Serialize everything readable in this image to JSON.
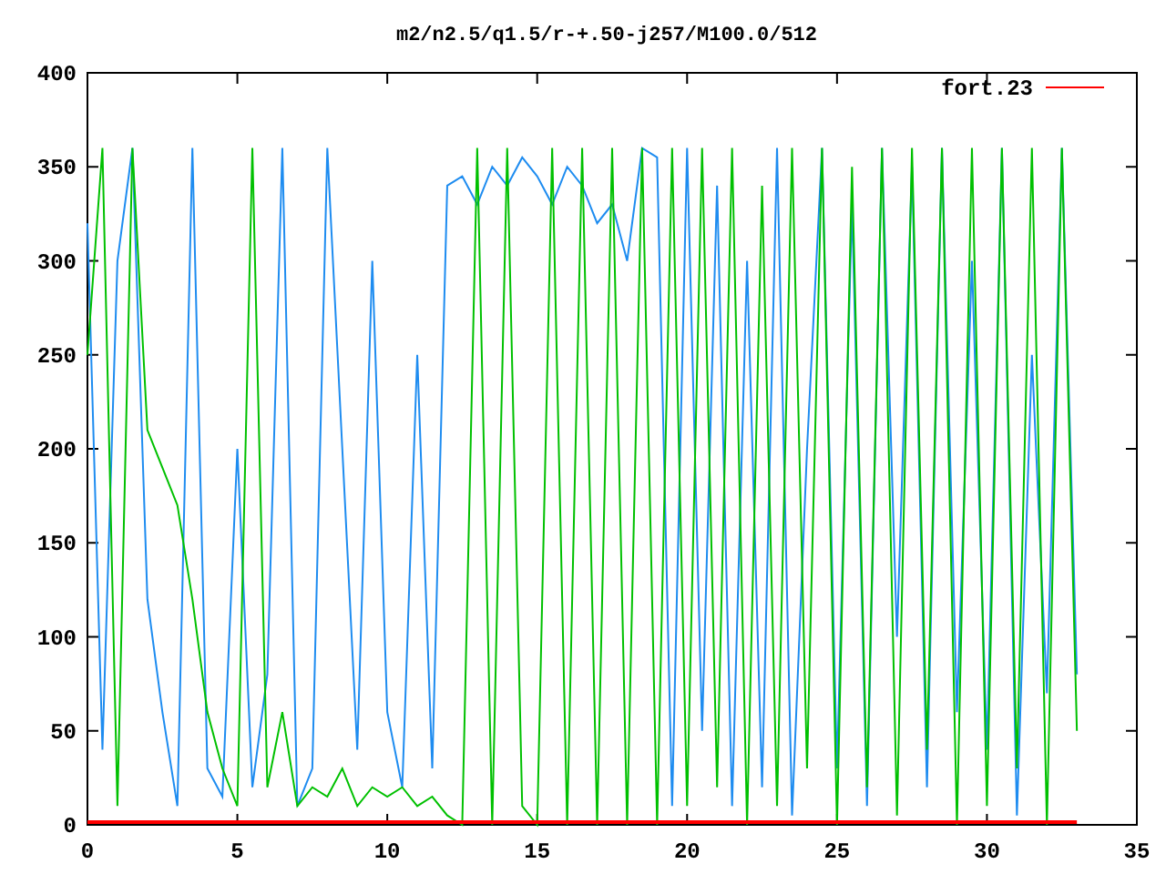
{
  "chart": {
    "chart_data": {
      "type": "line",
      "title": "m2/n2.5/q1.5/r-+.50-j257/M100.0/512",
      "x": [
        0,
        0.5,
        1,
        1.5,
        2,
        2.5,
        3,
        3.5,
        4,
        4.5,
        5,
        5.5,
        6,
        6.5,
        7,
        7.5,
        8,
        8.5,
        9,
        9.5,
        10,
        10.5,
        11,
        11.5,
        12,
        12.5,
        13,
        13.5,
        14,
        14.5,
        15,
        15.5,
        16,
        16.5,
        17,
        17.5,
        18,
        18.5,
        19,
        19.5,
        20,
        20.5,
        21,
        21.5,
        22,
        22.5,
        23,
        23.5,
        24,
        24.5,
        25,
        25.5,
        26,
        26.5,
        27,
        27.5,
        28,
        28.5,
        29,
        29.5,
        30,
        30.5,
        31,
        31.5,
        32,
        32.5,
        33
      ],
      "series": [
        {
          "name": "fort.23",
          "color": "#ff0000",
          "values": [
            0,
            0,
            0,
            0,
            0,
            0,
            0,
            0,
            0,
            0,
            0,
            0,
            0,
            0,
            0,
            0,
            0,
            0,
            0,
            0,
            0,
            0,
            0,
            0,
            0,
            0,
            0,
            0,
            0,
            0,
            0,
            0,
            0,
            0,
            0,
            0,
            0,
            0,
            0,
            0,
            0,
            0,
            0,
            0,
            0,
            0,
            0,
            0,
            0,
            0,
            0,
            0,
            0,
            0,
            0,
            0,
            0,
            0,
            0,
            0,
            0,
            0,
            0,
            0,
            0,
            0,
            0
          ]
        },
        {
          "color": "#1e8cf0",
          "values": [
            320,
            40,
            300,
            360,
            120,
            60,
            10,
            360,
            30,
            15,
            200,
            20,
            80,
            360,
            10,
            30,
            360,
            200,
            40,
            300,
            60,
            20,
            250,
            30,
            340,
            345,
            330,
            350,
            340,
            355,
            345,
            330,
            350,
            340,
            320,
            330,
            300,
            360,
            355,
            10,
            360,
            50,
            340,
            10,
            300,
            20,
            360,
            5,
            200,
            360,
            30,
            330,
            10,
            360,
            100,
            350,
            20,
            360,
            60,
            300,
            40,
            360,
            5,
            250,
            70,
            360,
            80
          ]
        },
        {
          "color": "#00c000",
          "values": [
            250,
            360,
            10,
            360,
            210,
            190,
            170,
            120,
            60,
            30,
            10,
            360,
            20,
            60,
            10,
            20,
            15,
            30,
            10,
            20,
            15,
            20,
            10,
            15,
            5,
            0,
            360,
            0,
            360,
            10,
            0,
            360,
            0,
            360,
            0,
            360,
            0,
            360,
            0,
            360,
            10,
            360,
            20,
            360,
            0,
            340,
            10,
            360,
            30,
            360,
            0,
            350,
            20,
            360,
            5,
            360,
            40,
            360,
            0,
            360,
            10,
            360,
            30,
            360,
            0,
            360,
            50
          ]
        }
      ],
      "xlim": [
        0,
        35
      ],
      "ylim": [
        0,
        400
      ],
      "xticks": [
        0,
        5,
        10,
        15,
        20,
        25,
        30,
        35
      ],
      "yticks": [
        0,
        50,
        100,
        150,
        200,
        250,
        300,
        350,
        400
      ]
    }
  }
}
